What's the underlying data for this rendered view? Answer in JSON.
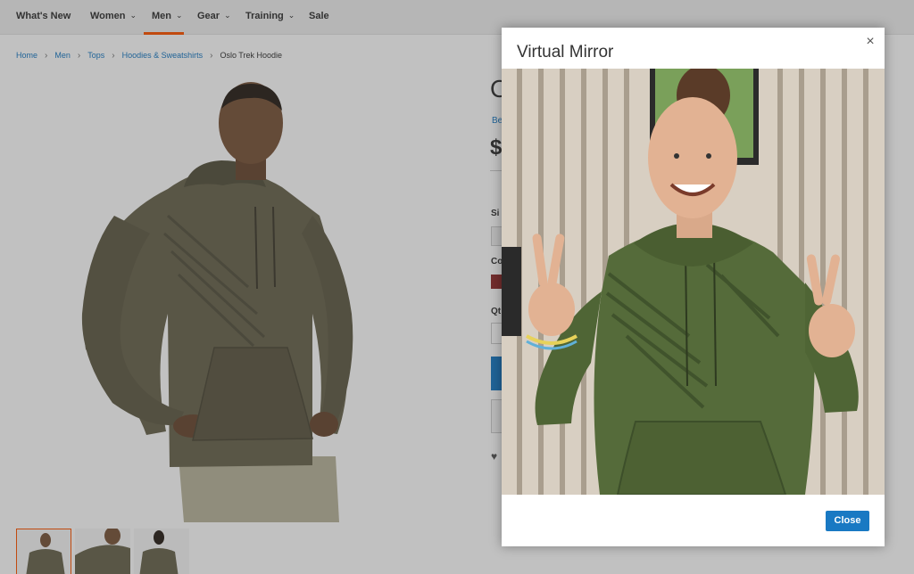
{
  "nav": {
    "items": [
      {
        "label": "What's New",
        "has_menu": false
      },
      {
        "label": "Women",
        "has_menu": true
      },
      {
        "label": "Men",
        "has_menu": true,
        "active": true
      },
      {
        "label": "Gear",
        "has_menu": true
      },
      {
        "label": "Training",
        "has_menu": true
      },
      {
        "label": "Sale",
        "has_menu": false
      }
    ],
    "chevron": "⌄"
  },
  "breadcrumb": {
    "items": [
      "Home",
      "Men",
      "Tops",
      "Hoodies & Sweatshirts"
    ],
    "current": "Oslo Trek Hoodie",
    "separator": "›"
  },
  "product_info_partial": {
    "title_glyph": "O",
    "review_glyph": "Be",
    "price_glyph": "$",
    "size_glyph": "Si",
    "color_glyph": "Co",
    "qty_glyph": "Qt",
    "heart_icon": "♥"
  },
  "modal": {
    "title": "Virtual Mirror",
    "close_icon": "×",
    "close_button": "Close"
  },
  "colors": {
    "accent_orange": "#ff5501",
    "link_blue": "#1979c3",
    "hoodie_olive": "#556b3a",
    "swatch_red": "#8f2b2b"
  }
}
